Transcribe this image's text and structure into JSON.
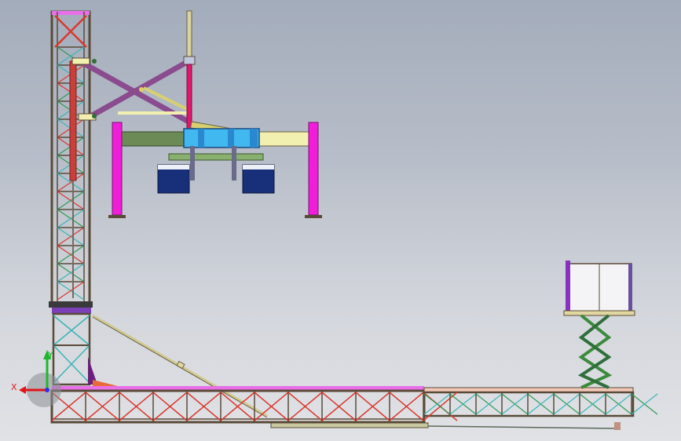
{
  "viewport": {
    "background_top": "#a3acbb",
    "background_bottom": "#e1e2e6"
  },
  "triad": {
    "x_label": "X",
    "y_label": "Y",
    "x_color": "#e0161a",
    "y_color": "#1db82a",
    "z_color": "#3030e0"
  },
  "colors": {
    "frame": "#5a4a38",
    "truss_top": "#e86fe8",
    "cross_red": "#d9382e",
    "cross_green": "#2f9a55",
    "cross_cyan": "#3ab5b5",
    "scissor_purple": "#8a4b8f",
    "magenta_leg": "#f01ed8",
    "cyan_block": "#41b8f0",
    "navy_box": "#18307a",
    "olive_beam": "#6b8a55",
    "cream_beam": "#f2f0b0",
    "scissor_green": "#3c8a3c"
  }
}
